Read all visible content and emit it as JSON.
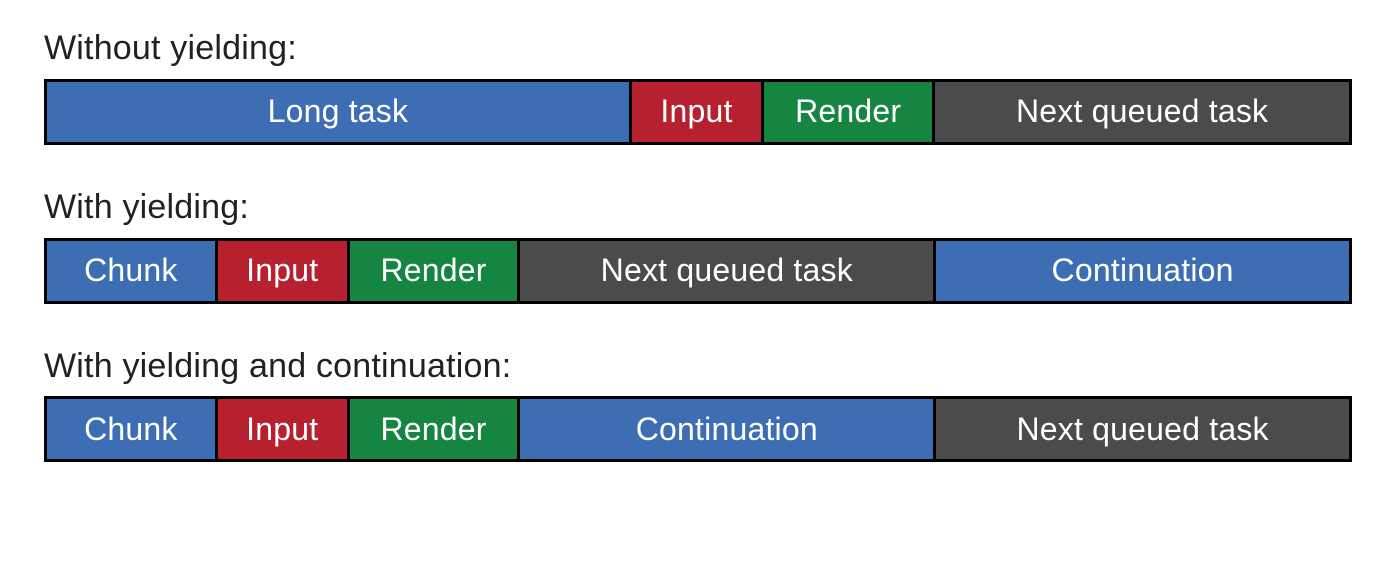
{
  "diagram": {
    "sections": [
      {
        "title": "Without yielding:",
        "segments": [
          {
            "label": "Long task",
            "color": "blue",
            "flex": 45
          },
          {
            "label": "Input",
            "color": "red",
            "flex": 10
          },
          {
            "label": "Render",
            "color": "green",
            "flex": 13
          },
          {
            "label": "Next queued task",
            "color": "grey",
            "flex": 32
          }
        ]
      },
      {
        "title": "With yielding:",
        "segments": [
          {
            "label": "Chunk",
            "color": "blue",
            "flex": 13
          },
          {
            "label": "Input",
            "color": "red",
            "flex": 10
          },
          {
            "label": "Render",
            "color": "green",
            "flex": 13
          },
          {
            "label": "Next queued task",
            "color": "grey",
            "flex": 32
          },
          {
            "label": "Continuation",
            "color": "blue",
            "flex": 32
          }
        ]
      },
      {
        "title": "With yielding and continuation:",
        "segments": [
          {
            "label": "Chunk",
            "color": "blue",
            "flex": 13
          },
          {
            "label": "Input",
            "color": "red",
            "flex": 10
          },
          {
            "label": "Render",
            "color": "green",
            "flex": 13
          },
          {
            "label": "Continuation",
            "color": "blue",
            "flex": 32
          },
          {
            "label": "Next queued task",
            "color": "grey",
            "flex": 32
          }
        ]
      }
    ]
  },
  "colors": {
    "blue": "#3d6db2",
    "red": "#b7202e",
    "green": "#158541",
    "grey": "#4b4b4b"
  }
}
